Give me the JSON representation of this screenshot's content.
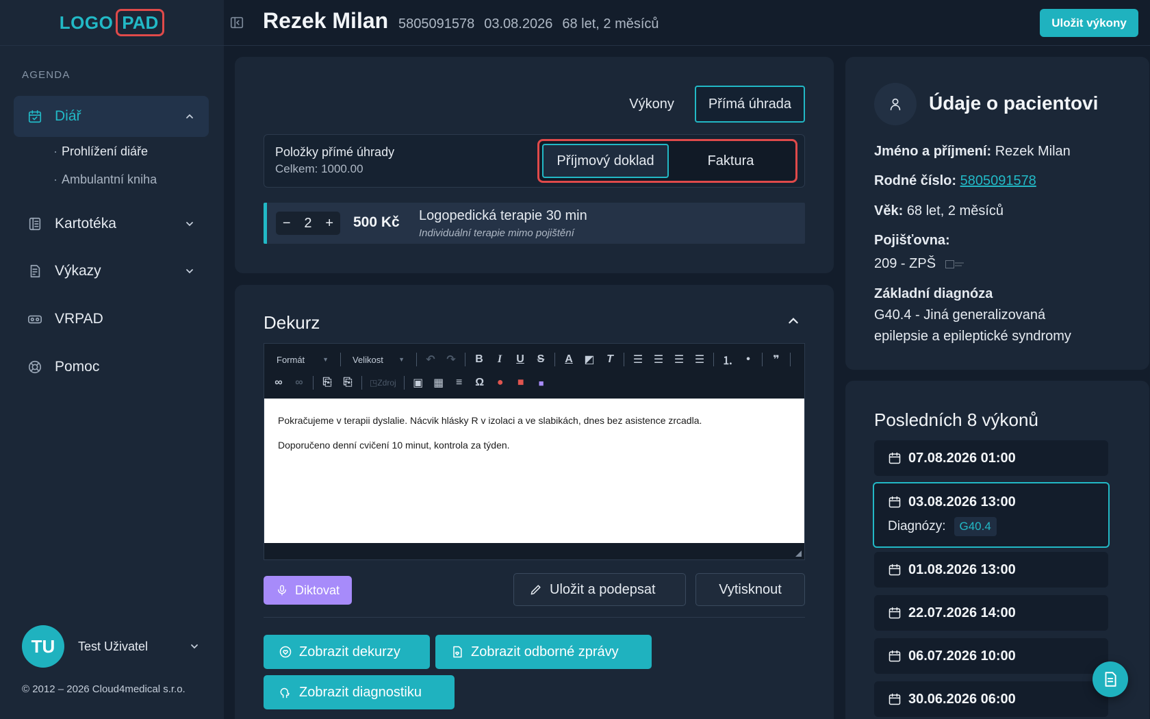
{
  "brand": {
    "logo": "LOGO",
    "pad": "PAD"
  },
  "sidebar": {
    "section": "AGENDA",
    "items": [
      {
        "label": "Diář",
        "icon": "calendar-icon"
      },
      {
        "label": "Kartotéka",
        "icon": "book-icon"
      },
      {
        "label": "Výkazy",
        "icon": "report-icon"
      },
      {
        "label": "VRPAD",
        "icon": "vr-headset-icon"
      },
      {
        "label": "Pomoc",
        "icon": "lifebuoy-icon"
      }
    ],
    "subitems": [
      {
        "label": "Prohlížení diáře"
      },
      {
        "label": "Ambulantní kniha"
      }
    ],
    "user": {
      "initials": "TU",
      "name": "Test Uživatel"
    },
    "copyright": "© 2012 – 2026 Cloud4medical s.r.o."
  },
  "header": {
    "name": "Rezek Milan",
    "birth_number": "5805091578",
    "date": "03.08.2026",
    "age": "68 let, 2 měsíců",
    "save_label": "Uložit výkony"
  },
  "payments": {
    "tabs": [
      "Výkony",
      "Přímá úhrada"
    ],
    "active_tab": "Přímá úhrada",
    "title": "Položky přímé úhrady",
    "total": "Celkem: 1000.00",
    "doc_types": [
      "Příjmový doklad",
      "Faktura"
    ],
    "active_doc_type": "Příjmový doklad",
    "service": {
      "quantity": "2",
      "minus": "−",
      "plus": "+",
      "price": "500 Kč",
      "name": "Logopedická terapie 30 min",
      "note": "Individuální terapie mimo pojištění"
    }
  },
  "dekurz": {
    "title": "Dekurz",
    "toolbar": {
      "format": "Formát",
      "size": "Velikost",
      "source": "Zdroj"
    },
    "text": [
      "Pokračujeme v terapii dyslalie. Nácvik hlásky R v izolaci a ve slabikách, dnes bez asistence zrcadla.",
      "Doporučeno denní cvičení 10 minut, kontrola za týden."
    ],
    "dictate": "Diktovat",
    "save_sign": "Uložit a podepsat",
    "print": "Vytisknout",
    "show_dekurz": "Zobrazit dekurzy",
    "show_reports": "Zobrazit odborné zprávy",
    "show_diagnostics": "Zobrazit diagnostiku"
  },
  "patient": {
    "title": "Údaje o pacientovi",
    "name_label": "Jméno a příjmení:",
    "name": "Rezek Milan",
    "rc_label": "Rodné číslo:",
    "rc": "5805091578",
    "age_label": "Věk:",
    "age": "68 let, 2 měsíců",
    "insurance_label": "Pojišťovna:",
    "insurance": "209 - ZPŠ",
    "diagnosis_label": "Základní diagnóza",
    "diagnosis_line1": "G40.4 - Jiná generalizovaná",
    "diagnosis_line2": "epilepsie a epileptické syndromy"
  },
  "visits": {
    "title": "Posledních 8 výkonů",
    "items": [
      "07.08.2026 01:00",
      "03.08.2026 13:00",
      "01.08.2026 13:00",
      "22.07.2026 14:00",
      "06.07.2026 10:00",
      "30.06.2026 06:00"
    ],
    "selected_diag_label": "Diagnózy:",
    "selected_diag": "G40.4"
  },
  "colors": {
    "accent": "#1fb2bf",
    "highlight": "#e04a4a",
    "dictate": "#a78bfa"
  }
}
